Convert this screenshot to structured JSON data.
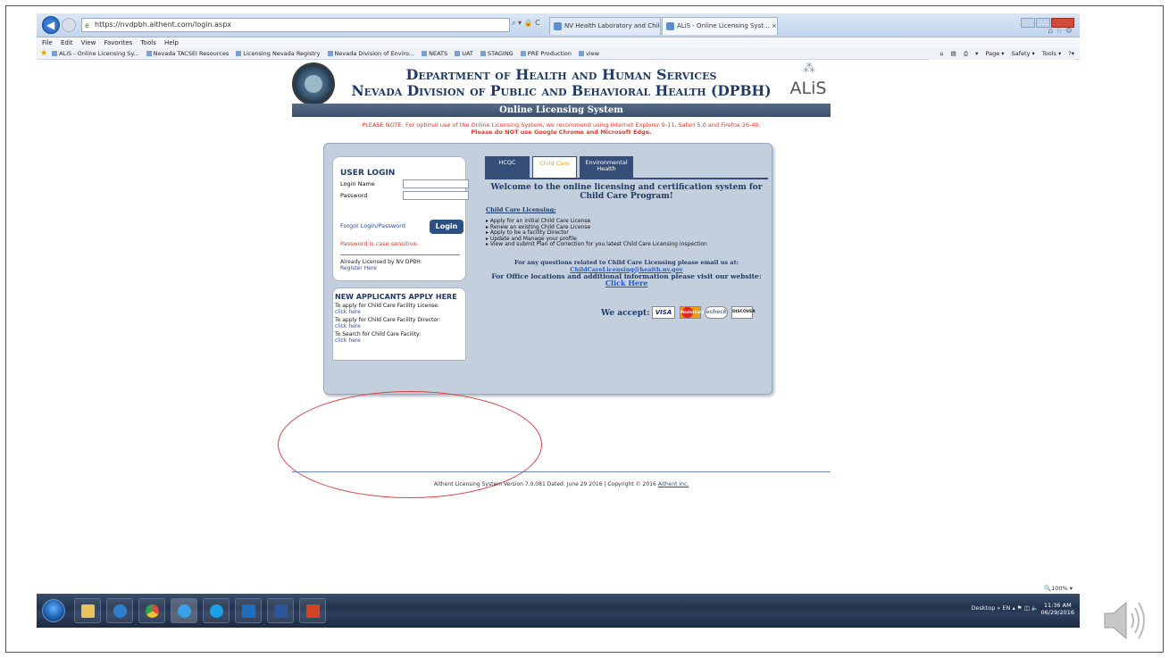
{
  "browser": {
    "address": "https://nvdpbh.aithent.com/login.aspx",
    "address_tools": "⌕ ▾ 🔒 C",
    "tabs": [
      "NV Health Laboratory and Child C...",
      "ALiS - Online Licensing Syst... ×"
    ],
    "menu": [
      "File",
      "Edit",
      "View",
      "Favorites",
      "Tools",
      "Help"
    ],
    "favorites": [
      "ALiS - Online Licensing Sy...",
      "Nevada TACSEI Resources",
      "Licensing Nevada Registry",
      "Nevada Division of Enviro...",
      "NEATS",
      "UAT",
      "STAGING",
      "PRE Production",
      "view"
    ],
    "commands": [
      "▾",
      "Page ▾",
      "Safety ▾",
      "Tools ▾",
      "?▾"
    ],
    "right_icons": "⌂ ☆ ⚙",
    "zoom": "100%"
  },
  "header": {
    "line1": "Department of Health and Human Services",
    "line2": "Nevada Division of Public and Behavioral Health (DPBH)",
    "logo_text": "ALiS"
  },
  "banner": "Online Licensing System",
  "notice": {
    "line1": "PLEASE NOTE: For optimal use of the Online Licensing System, we recommend using Internet Explorer 9-11, Safari 5.0 and Firefox 26-40.",
    "line2": "Please do NOT use Google Chrome and Microsoft Edge."
  },
  "login": {
    "title": "USER LOGIN",
    "login_name_label": "Login Name",
    "password_label": "Password",
    "forgot": "Forgot Login/Password",
    "button": "Login",
    "case_note": "Password is case sensitive.",
    "licensed_note": "Already Licensed by NV DPBH:",
    "register": "Register Here"
  },
  "apply": {
    "title": "NEW APPLICANTS APPLY HERE",
    "items": [
      {
        "label": "To apply for Child Care Facility License:",
        "link": "click here"
      },
      {
        "label": "To apply for Child Care Facility Director:",
        "link": "click here"
      },
      {
        "label": "To Search for Child Care Facility:",
        "link": "click here"
      }
    ]
  },
  "program_tabs": {
    "hcqc": "HCQC",
    "childcare": "Child Care",
    "env_line1": "Environmental",
    "env_line2": "Health"
  },
  "welcome": "Welcome to the online licensing and certification system for Child Care Program!",
  "cc_heading": "Child Care Licensing:",
  "cc_list": [
    "Apply for an initial Child Care License",
    "Renew an existing Child Care License",
    "Apply to be a facility Director",
    "Update and Manage your profile",
    "View and submit Plan of Correction for you latest Child Care Licensing inspection"
  ],
  "contact": {
    "line1": "For any questions related to Child Care Licensing please email us at:",
    "email": "ChildCareLicensing@health.nv.gov",
    "line2": "For Office locations and additional information please visit our website:",
    "link": "Click Here"
  },
  "payment": {
    "label": "We accept:",
    "cards": [
      "VISA",
      "MasterCard",
      "echeck",
      "DISCOVER"
    ]
  },
  "footer": {
    "text": "Aithent Licensing System Version 7.0.081 Dated: June 29 2016 | Copyright © 2016",
    "link": "Aithent Inc."
  },
  "taskbar": {
    "tray": "Desktop  »  EN  ▴  ⚑  ◫  🔈",
    "time": "11:36 AM",
    "date": "06/29/2016"
  },
  "colors": {
    "navy": "#1f3a68",
    "warning_red": "#e32",
    "link_blue": "#2a4aa0",
    "annotation_red": "#e04040"
  }
}
